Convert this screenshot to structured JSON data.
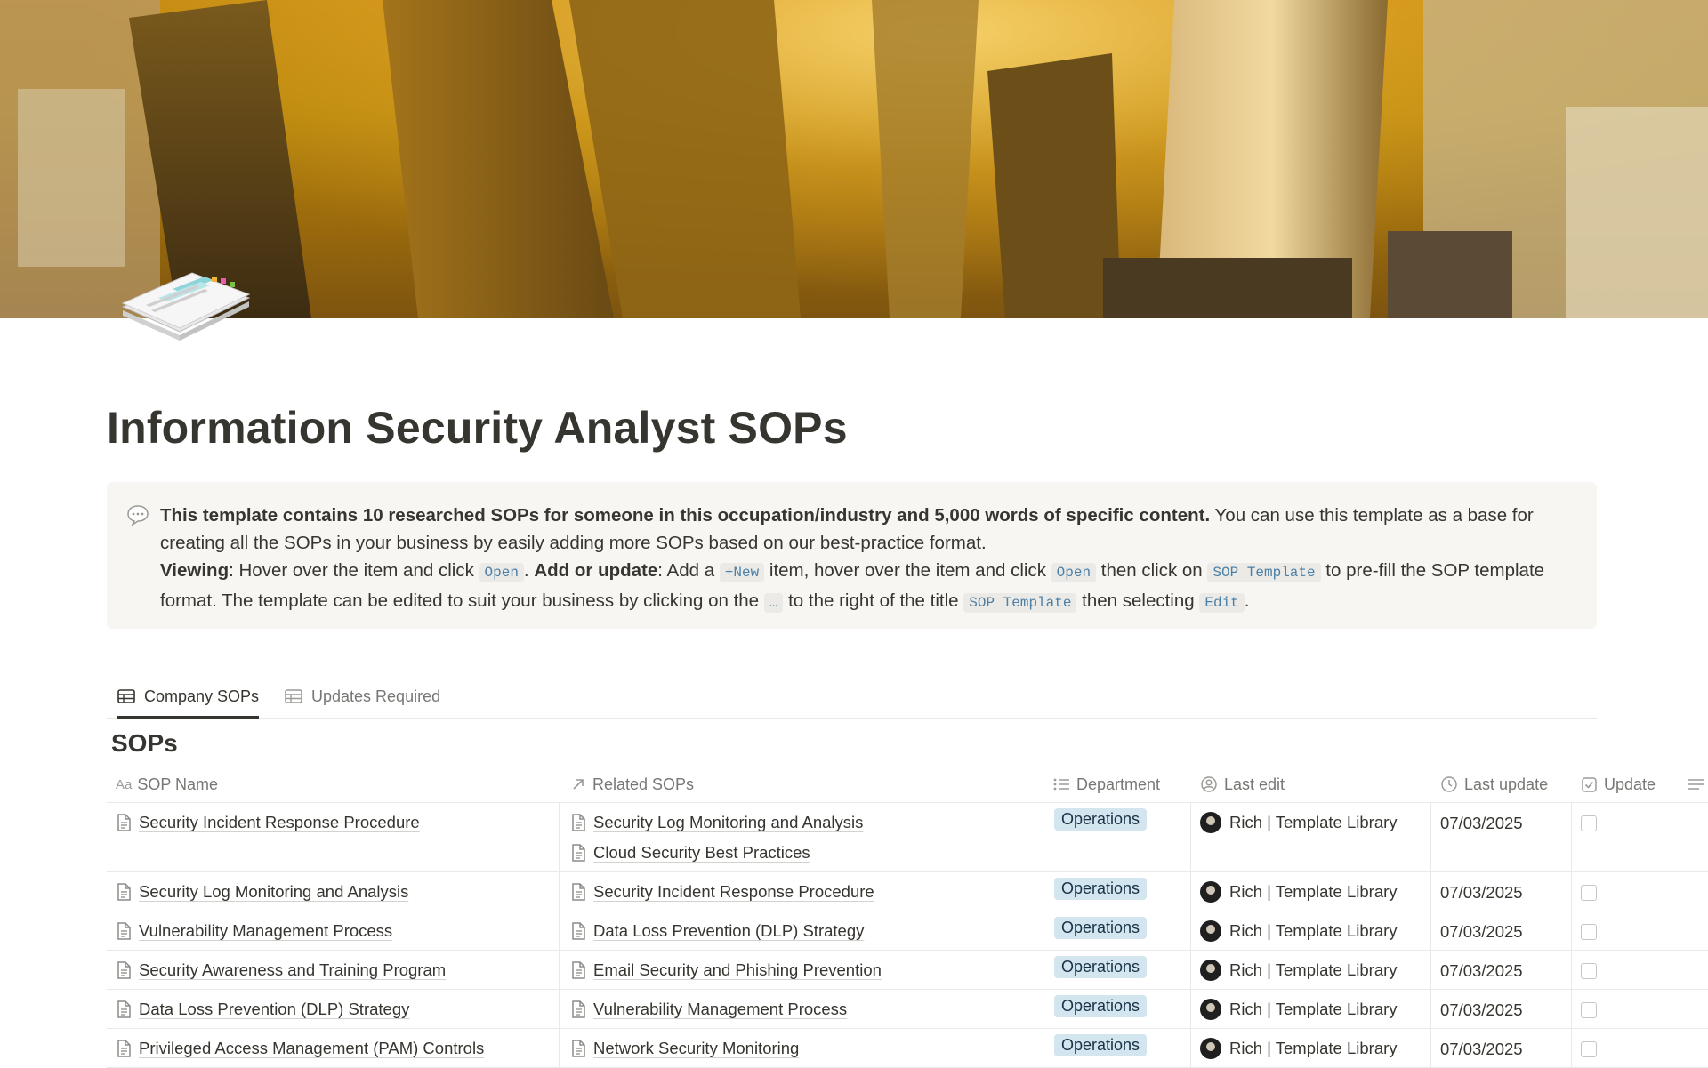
{
  "page": {
    "title": "Information Security Analyst SOPs"
  },
  "callout": {
    "bold_intro": "This template contains 10 researched SOPs for someone in this occupation/industry and 5,000 words of specific content.",
    "intro_rest": " You can use this template as a base for creating all the SOPs in your business by easily adding more SOPs based on our best-practice format.",
    "viewing_label": "Viewing",
    "viewing_text": ": Hover over the item and click ",
    "code_open": "Open",
    "period": ".",
    "add_label": "Add or update",
    "add_text_1": ": Add a ",
    "code_new": "+New",
    "add_text_2": " item, hover over the item and click ",
    "add_text_3": " then click on ",
    "code_sop_template": "SOP Template",
    "add_text_4": " to pre-fill the SOP template format. The template can be edited to suit your business by clicking on the ",
    "code_dots": "…",
    "add_text_5": " to the right of the title ",
    "add_text_6": " then selecting ",
    "code_edit": "Edit",
    "end": "."
  },
  "tabs": [
    {
      "label": "Company SOPs",
      "active": true
    },
    {
      "label": "Updates Required",
      "active": false
    }
  ],
  "section_title": "SOPs",
  "columns": {
    "name": "SOP Name",
    "related": "Related SOPs",
    "department": "Department",
    "last_edit": "Last edit",
    "last_update": "Last update",
    "update": "Update"
  },
  "rows": [
    {
      "name": "Security Incident Response Procedure",
      "related": [
        "Security Log Monitoring and Analysis",
        "Cloud Security Best Practices"
      ],
      "department": "Operations",
      "editor": "Rich | Template Library",
      "date": "07/03/2025",
      "checked": false
    },
    {
      "name": "Security Log Monitoring and Analysis",
      "related": [
        "Security Incident Response Procedure"
      ],
      "department": "Operations",
      "editor": "Rich | Template Library",
      "date": "07/03/2025",
      "checked": false
    },
    {
      "name": "Vulnerability Management Process",
      "related": [
        "Data Loss Prevention (DLP) Strategy"
      ],
      "department": "Operations",
      "editor": "Rich | Template Library",
      "date": "07/03/2025",
      "checked": false
    },
    {
      "name": "Security Awareness and Training Program",
      "related": [
        "Email Security and Phishing Prevention"
      ],
      "department": "Operations",
      "editor": "Rich | Template Library",
      "date": "07/03/2025",
      "checked": false
    },
    {
      "name": "Data Loss Prevention (DLP) Strategy",
      "related": [
        "Vulnerability Management Process"
      ],
      "department": "Operations",
      "editor": "Rich | Template Library",
      "date": "07/03/2025",
      "checked": false
    },
    {
      "name": "Privileged Access Management (PAM) Controls",
      "related": [
        "Network Security Monitoring"
      ],
      "department": "Operations",
      "editor": "Rich | Template Library",
      "date": "07/03/2025",
      "checked": false
    }
  ],
  "colors": {
    "accent_pill_bg": "#d3e5ef",
    "callout_bg": "#f7f6f3",
    "cover_gold": "#c58a12"
  }
}
